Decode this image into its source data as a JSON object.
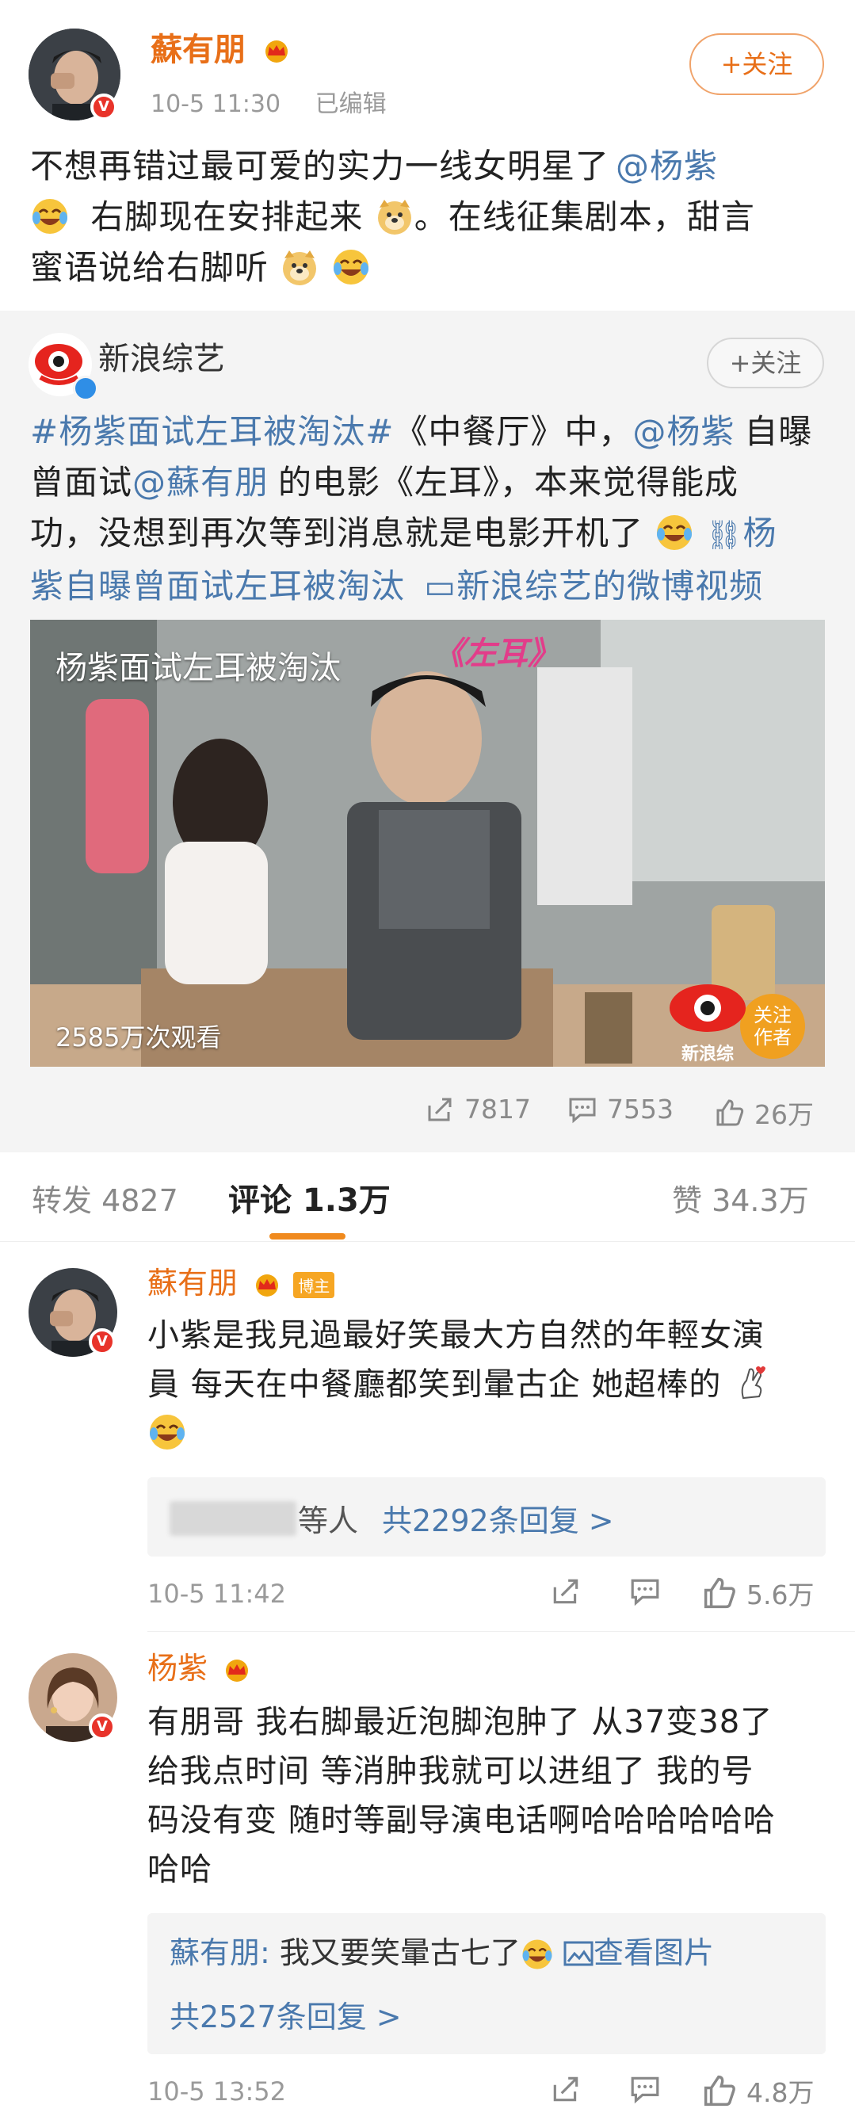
{
  "post": {
    "author": "蘇有朋",
    "time": "10-5 11:30",
    "edited": "已编辑",
    "follow": "+关注",
    "text": {
      "l1_a": "不想再错过最可爱的实力一线女明星了",
      "l1_mention": "@杨紫",
      "l2": "右脚现在安排起来",
      "l2_b": "。在线征集剧本，甜言",
      "l3": "蜜语说给右脚听"
    }
  },
  "repost": {
    "author": "新浪综艺",
    "follow": "+关注",
    "l1_hashtag": "#杨紫面试左耳被淘汰#",
    "l1_a": "《中餐厅》中，",
    "l1_mention": "@杨紫",
    "l1_b": "自曝",
    "l2_a": "曾面试",
    "l2_mention": "@蘇有朋",
    "l2_b": "的电影《左耳》，本来觉得能成",
    "l3_a": "功，没想到再次等到消息就是电影开机了",
    "l3_link": "杨",
    "l4_link": "紫自曝曾面试左耳被淘汰",
    "l4_video": "新浪综艺的微博视频",
    "video": {
      "title": "杨紫面试左耳被淘汰",
      "sticker": "《左耳》",
      "views": "2585万次观看",
      "follow_line1": "关注",
      "follow_line2": "作者",
      "brand": "新浪综"
    },
    "stats": {
      "share": "7817",
      "comment": "7553",
      "like": "26万"
    }
  },
  "tabs": {
    "repost": "转发 4827",
    "comment": "评论 1.3万",
    "like": "赞 34.3万"
  },
  "comments": [
    {
      "author": "蘇有朋",
      "badge": "博主",
      "l1": "小紫是我見過最好笑最大方自然的年輕女演",
      "l2": "員 每天在中餐廳都笑到暈古企 她超棒的",
      "replies_people": "等人",
      "replies_count": "共2292条回复 >",
      "time": "10-5 11:42",
      "likes": "5.6万"
    },
    {
      "author": "杨紫",
      "l1": "有朋哥 我右脚最近泡脚泡肿了 从37变38了",
      "l2": "给我点时间 等消肿我就可以进组了 我的号",
      "l3": "码没有变 随时等副导演电话啊哈哈哈哈哈哈",
      "l4": "哈哈",
      "reply_author": "蘇有朋:",
      "reply_text": "我又要笑暈古七了",
      "reply_link": "查看图片",
      "replies_count": "共2527条回复 >",
      "time": "10-5 13:52",
      "likes": "4.8万"
    }
  ],
  "colors": {
    "orange": "#e86f18",
    "blue": "#4a79ad",
    "grey_bg": "#f4f4f4"
  }
}
